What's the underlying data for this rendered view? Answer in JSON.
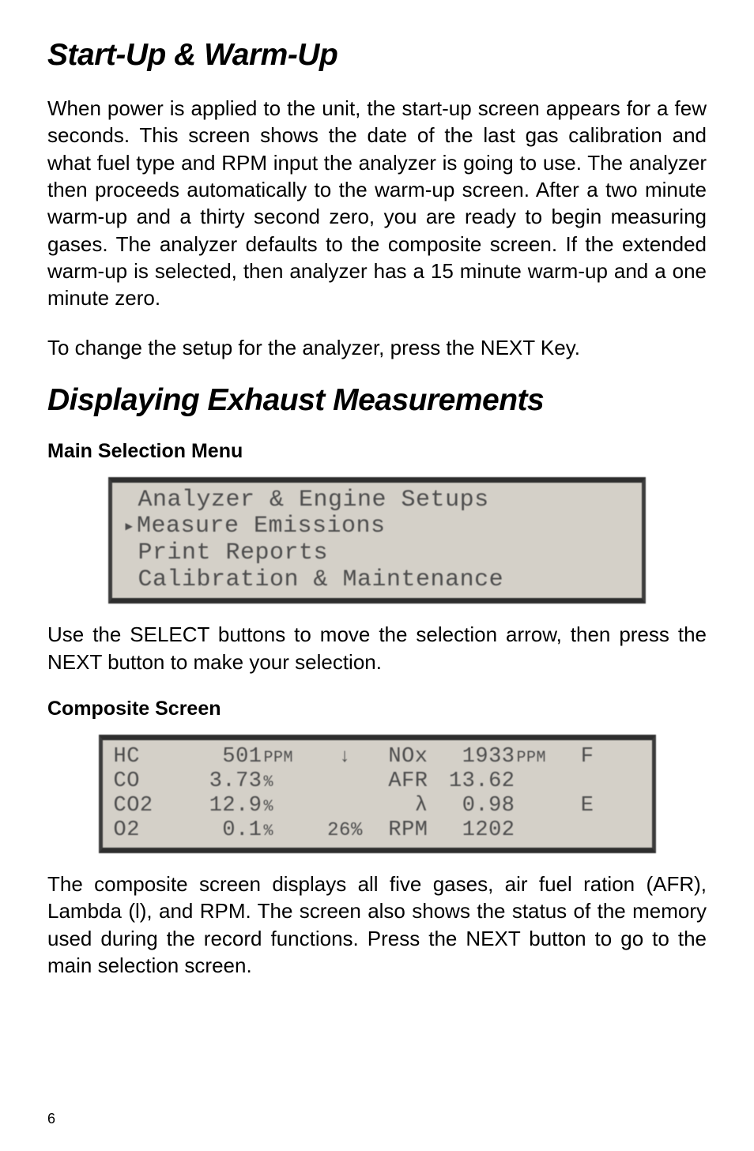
{
  "heading1": "Start-Up & Warm-Up",
  "para1": "When power is applied to the unit, the start-up screen appears for a few seconds.  This screen shows the date of the last gas calibration and what fuel type and RPM input the analyzer is going to use.  The analyzer then proceeds automatically to the warm-up screen.  After a two minute warm-up and a thirty second zero, you are ready to begin measuring gases.  The analyzer defaults to the composite screen.  If the extended warm-up is selected, then analyzer has a 15 minute warm-up and a one minute zero.",
  "para2": "To change the setup for the analyzer, press the NEXT Key.",
  "heading2": "Displaying Exhaust Measurements",
  "sub1": "Main Selection Menu",
  "menu": {
    "items": [
      " Analyzer & Engine Setups",
      "Measure Emissions",
      " Print Reports",
      " Calibration & Maintenance"
    ],
    "selected_index": 1
  },
  "para3": "Use the SELECT buttons to move the selection arrow, then press the NEXT button to make your selection.",
  "sub2": "Composite  Screen",
  "composite": {
    "rows": [
      {
        "lbl": "HC",
        "val": "501",
        "unit": "PPM",
        "mid": "↓",
        "lbl2": "NOx",
        "val2": "1933",
        "unit2": "PPM",
        "status": "F"
      },
      {
        "lbl": "CO",
        "val": "3.73",
        "unit": "%",
        "mid": "",
        "lbl2": "AFR",
        "val2": "13.62",
        "unit2": "",
        "status": ""
      },
      {
        "lbl": "CO2",
        "val": "12.9",
        "unit": "%",
        "mid": "",
        "lbl2": "λ",
        "val2": "0.98",
        "unit2": "",
        "status": "E"
      },
      {
        "lbl": "O2",
        "val": "0.1",
        "unit": "%",
        "mid": "26%",
        "lbl2": "RPM",
        "val2": "1202",
        "unit2": "",
        "status": ""
      }
    ]
  },
  "para4": "The composite screen displays all five gases, air fuel ration (AFR), Lambda (l), and RPM.  The screen also shows the status of the memory used during the record functions.  Press the NEXT button to go to the main selection screen.",
  "page_number": "6"
}
